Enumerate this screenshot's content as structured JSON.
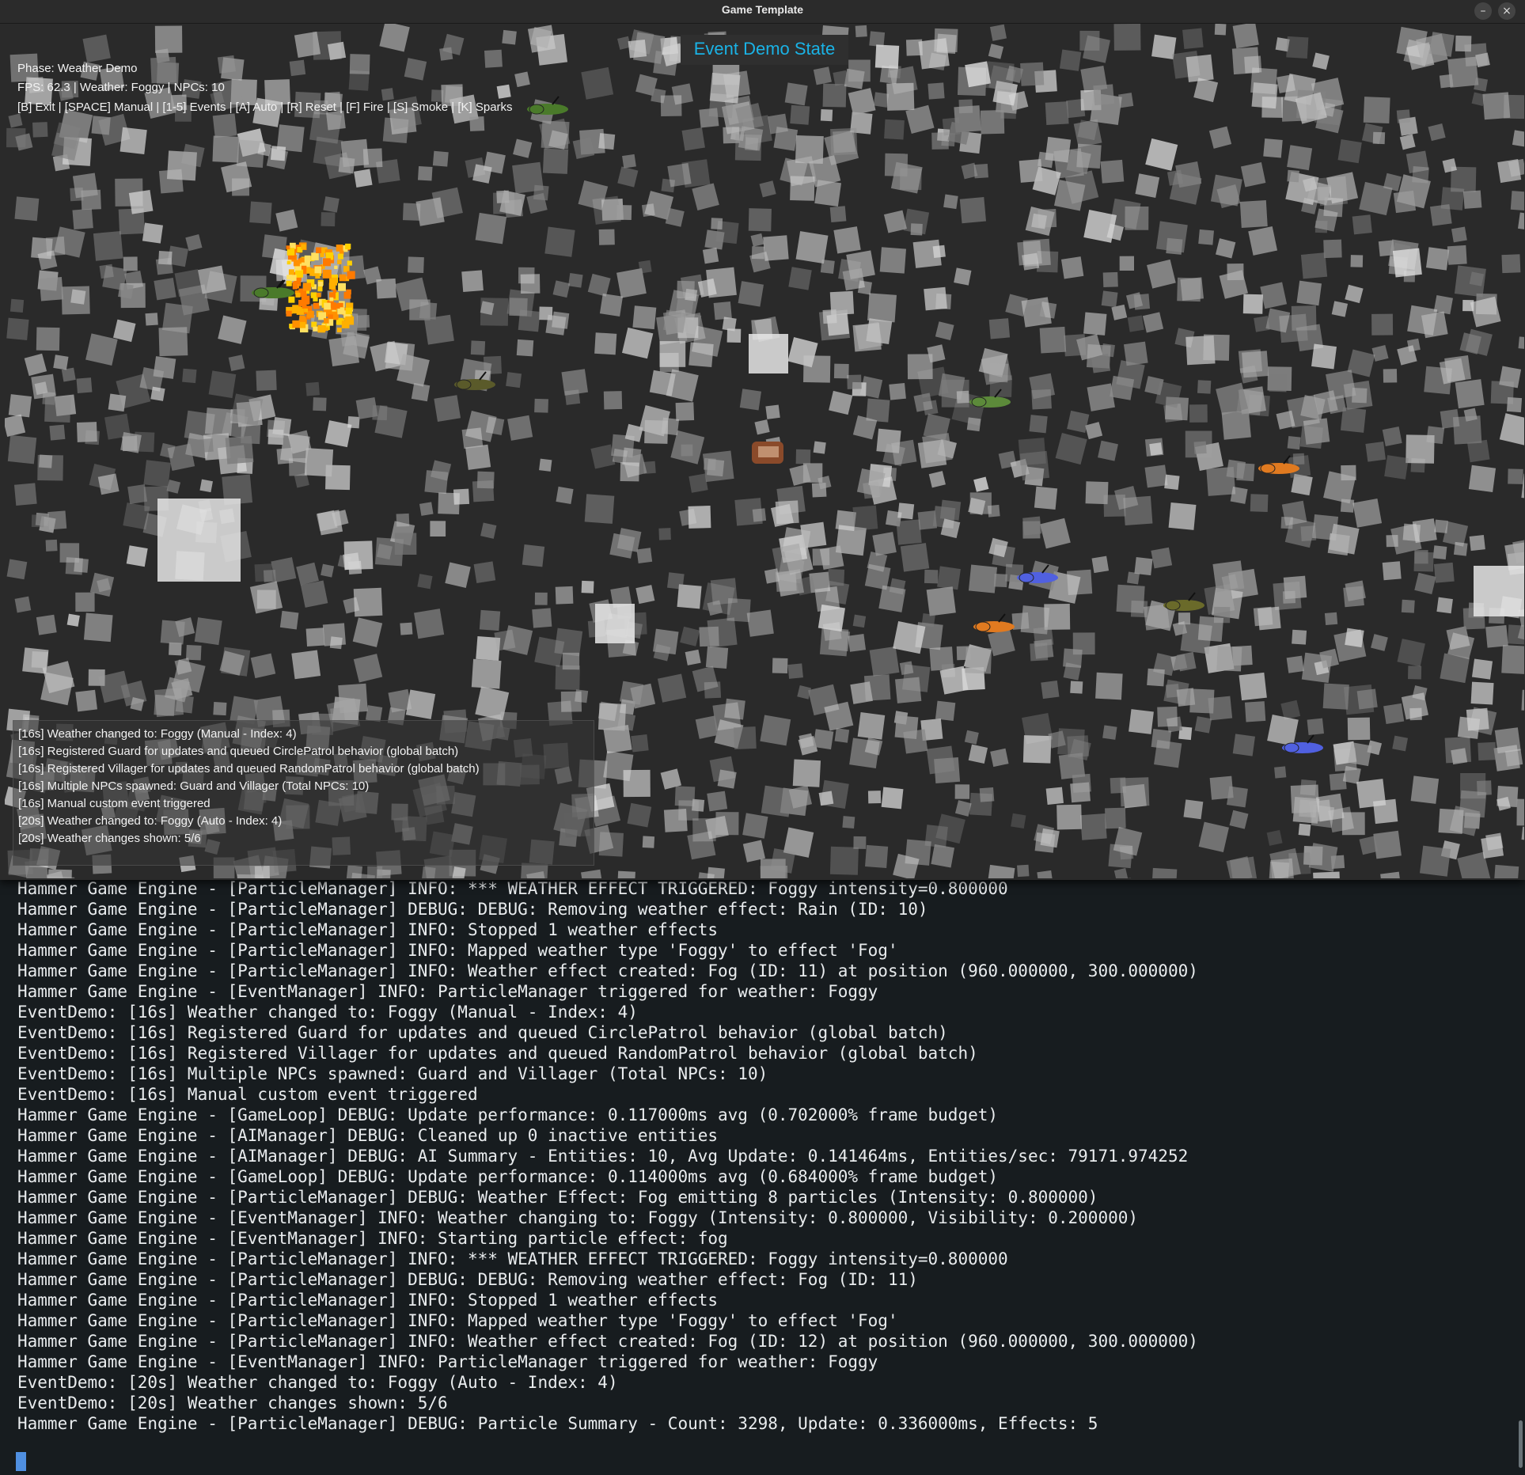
{
  "window": {
    "title": "Game Template",
    "minimize_icon": "minimize-icon",
    "close_icon": "close-icon",
    "minimize_glyph": "–",
    "close_glyph": "×"
  },
  "game": {
    "state_title": "Event Demo State",
    "hud": {
      "phase": "Phase: Weather Demo",
      "status": "FPS: 62.3 | Weather: Foggy | NPCs: 10",
      "controls": "[B] Exit | [SPACE] Manual | [1-5] Events | [A] Auto | [R] Reset | [F] Fire | [S] Smoke | [K] Sparks"
    },
    "event_log": [
      "[16s] Weather changed to: Foggy (Manual - Index: 4)",
      "[16s] Registered Guard for updates and queued CirclePatrol behavior (global batch)",
      "[16s] Registered Villager for updates and queued RandomPatrol behavior (global batch)",
      "[16s] Multiple NPCs spawned: Guard and Villager (Total NPCs: 10)",
      "[16s] Manual custom event triggered",
      "[20s] Weather changed to: Foggy (Auto - Index: 4)",
      "[20s] Weather changes shown: 5/6"
    ],
    "colors": {
      "title": "#1ab3e6",
      "background": "#2a2a2a",
      "fog": "#9a9a9a",
      "fire": "#ffb000"
    }
  },
  "terminal": {
    "lines": [
      "Hammer Game Engine - [EventManager] INFO: Starting particle effect: fog",
      "Hammer Game Engine - [ParticleManager] INFO: *** WEATHER EFFECT TRIGGERED: Foggy intensity=0.800000",
      "Hammer Game Engine - [ParticleManager] DEBUG: DEBUG: Removing weather effect: Rain (ID: 10)",
      "Hammer Game Engine - [ParticleManager] INFO: Stopped 1 weather effects",
      "Hammer Game Engine - [ParticleManager] INFO: Mapped weather type 'Foggy' to effect 'Fog'",
      "Hammer Game Engine - [ParticleManager] INFO: Weather effect created: Fog (ID: 11) at position (960.000000, 300.000000)",
      "Hammer Game Engine - [EventManager] INFO: ParticleManager triggered for weather: Foggy",
      "EventDemo: [16s] Weather changed to: Foggy (Manual - Index: 4)",
      "EventDemo: [16s] Registered Guard for updates and queued CirclePatrol behavior (global batch)",
      "EventDemo: [16s] Registered Villager for updates and queued RandomPatrol behavior (global batch)",
      "EventDemo: [16s] Multiple NPCs spawned: Guard and Villager (Total NPCs: 10)",
      "EventDemo: [16s] Manual custom event triggered",
      "Hammer Game Engine - [GameLoop] DEBUG: Update performance: 0.117000ms avg (0.702000% frame budget)",
      "Hammer Game Engine - [AIManager] DEBUG: Cleaned up 0 inactive entities",
      "Hammer Game Engine - [AIManager] DEBUG: AI Summary - Entities: 10, Avg Update: 0.141464ms, Entities/sec: 79171.974252",
      "Hammer Game Engine - [GameLoop] DEBUG: Update performance: 0.114000ms avg (0.684000% frame budget)",
      "Hammer Game Engine - [ParticleManager] DEBUG: Weather Effect: Fog emitting 8 particles (Intensity: 0.800000)",
      "Hammer Game Engine - [EventManager] INFO: Weather changing to: Foggy (Intensity: 0.800000, Visibility: 0.200000)",
      "Hammer Game Engine - [EventManager] INFO: Starting particle effect: fog",
      "Hammer Game Engine - [ParticleManager] INFO: *** WEATHER EFFECT TRIGGERED: Foggy intensity=0.800000",
      "Hammer Game Engine - [ParticleManager] DEBUG: DEBUG: Removing weather effect: Fog (ID: 11)",
      "Hammer Game Engine - [ParticleManager] INFO: Stopped 1 weather effects",
      "Hammer Game Engine - [ParticleManager] INFO: Mapped weather type 'Foggy' to effect 'Fog'",
      "Hammer Game Engine - [ParticleManager] INFO: Weather effect created: Fog (ID: 12) at position (960.000000, 300.000000)",
      "Hammer Game Engine - [EventManager] INFO: ParticleManager triggered for weather: Foggy",
      "EventDemo: [20s] Weather changed to: Foggy (Auto - Index: 4)",
      "EventDemo: [20s] Weather changes shown: 5/6",
      "Hammer Game Engine - [ParticleManager] DEBUG: Particle Summary - Count: 3298, Update: 0.336000ms, Effects: 5"
    ],
    "colors": {
      "text": "#e9ecee",
      "background": "#171c1f",
      "cursor": "#4f8fe0"
    }
  },
  "npcs": [
    {
      "kind": "ant",
      "color": "#4a7a2a"
    },
    {
      "kind": "ant",
      "color": "#5a5a2a"
    },
    {
      "kind": "ant",
      "color": "#5c8a3a"
    },
    {
      "kind": "ant",
      "color": "#e07a20"
    },
    {
      "kind": "ant",
      "color": "#5060e0"
    },
    {
      "kind": "ant",
      "color": "#6a6a2a"
    },
    {
      "kind": "ant",
      "color": "#e07a20"
    },
    {
      "kind": "ant",
      "color": "#5060e0"
    },
    {
      "kind": "ant",
      "color": "#4a7a2a"
    },
    {
      "kind": "ant",
      "color": "#4a7a2a"
    },
    {
      "kind": "beetle",
      "color": "#8a4a2a"
    }
  ]
}
